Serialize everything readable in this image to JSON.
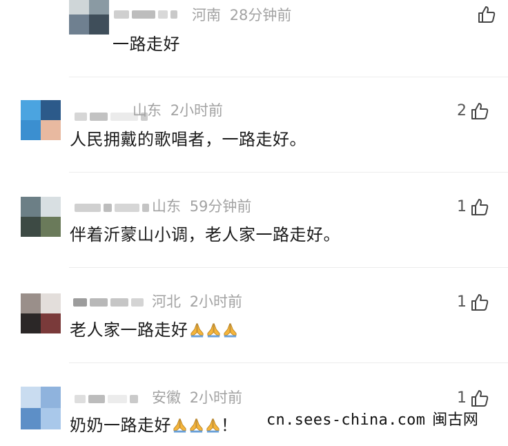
{
  "comments": [
    {
      "location": "河南",
      "time": "28分钟前",
      "text": "一路走好",
      "likes": "",
      "emoji_count": 0,
      "suffix": ""
    },
    {
      "location": "山东",
      "time": "2小时前",
      "text": "人民拥戴的歌唱者，一路走好。",
      "likes": "2",
      "emoji_count": 0,
      "suffix": ""
    },
    {
      "location": "山东",
      "time": "59分钟前",
      "text": "伴着沂蒙山小调，老人家一路走好。",
      "likes": "1",
      "emoji_count": 0,
      "suffix": ""
    },
    {
      "location": "河北",
      "time": "2小时前",
      "text": "老人家一路走好",
      "likes": "1",
      "emoji_count": 3,
      "suffix": ""
    },
    {
      "location": "安徽",
      "time": "2小时前",
      "text": "奶奶一路走好",
      "likes": "1",
      "emoji_count": 3,
      "suffix": "！"
    }
  ],
  "icons": {
    "like": "thumbs-up-icon",
    "emoji": "praying-hands-emoji"
  },
  "colors": {
    "meta": "#a2a2a2",
    "text": "#1b1b1b",
    "divider": "#ececec",
    "emoji": "#f5b53c"
  },
  "watermark": {
    "domain": "cn.sees-china.com",
    "name": "闽古网"
  }
}
